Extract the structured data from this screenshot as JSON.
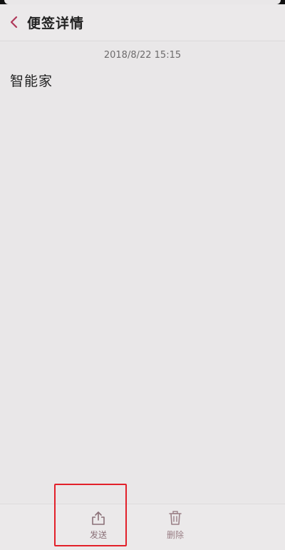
{
  "header": {
    "title": "便签详情"
  },
  "note": {
    "timestamp": "2018/8/22 15:15",
    "content": "智能家"
  },
  "bottom_bar": {
    "send_label": "发送",
    "delete_label": "删除"
  },
  "colors": {
    "accent": "#b0385a",
    "highlight": "#e2202a",
    "background": "#e9e7e8"
  }
}
